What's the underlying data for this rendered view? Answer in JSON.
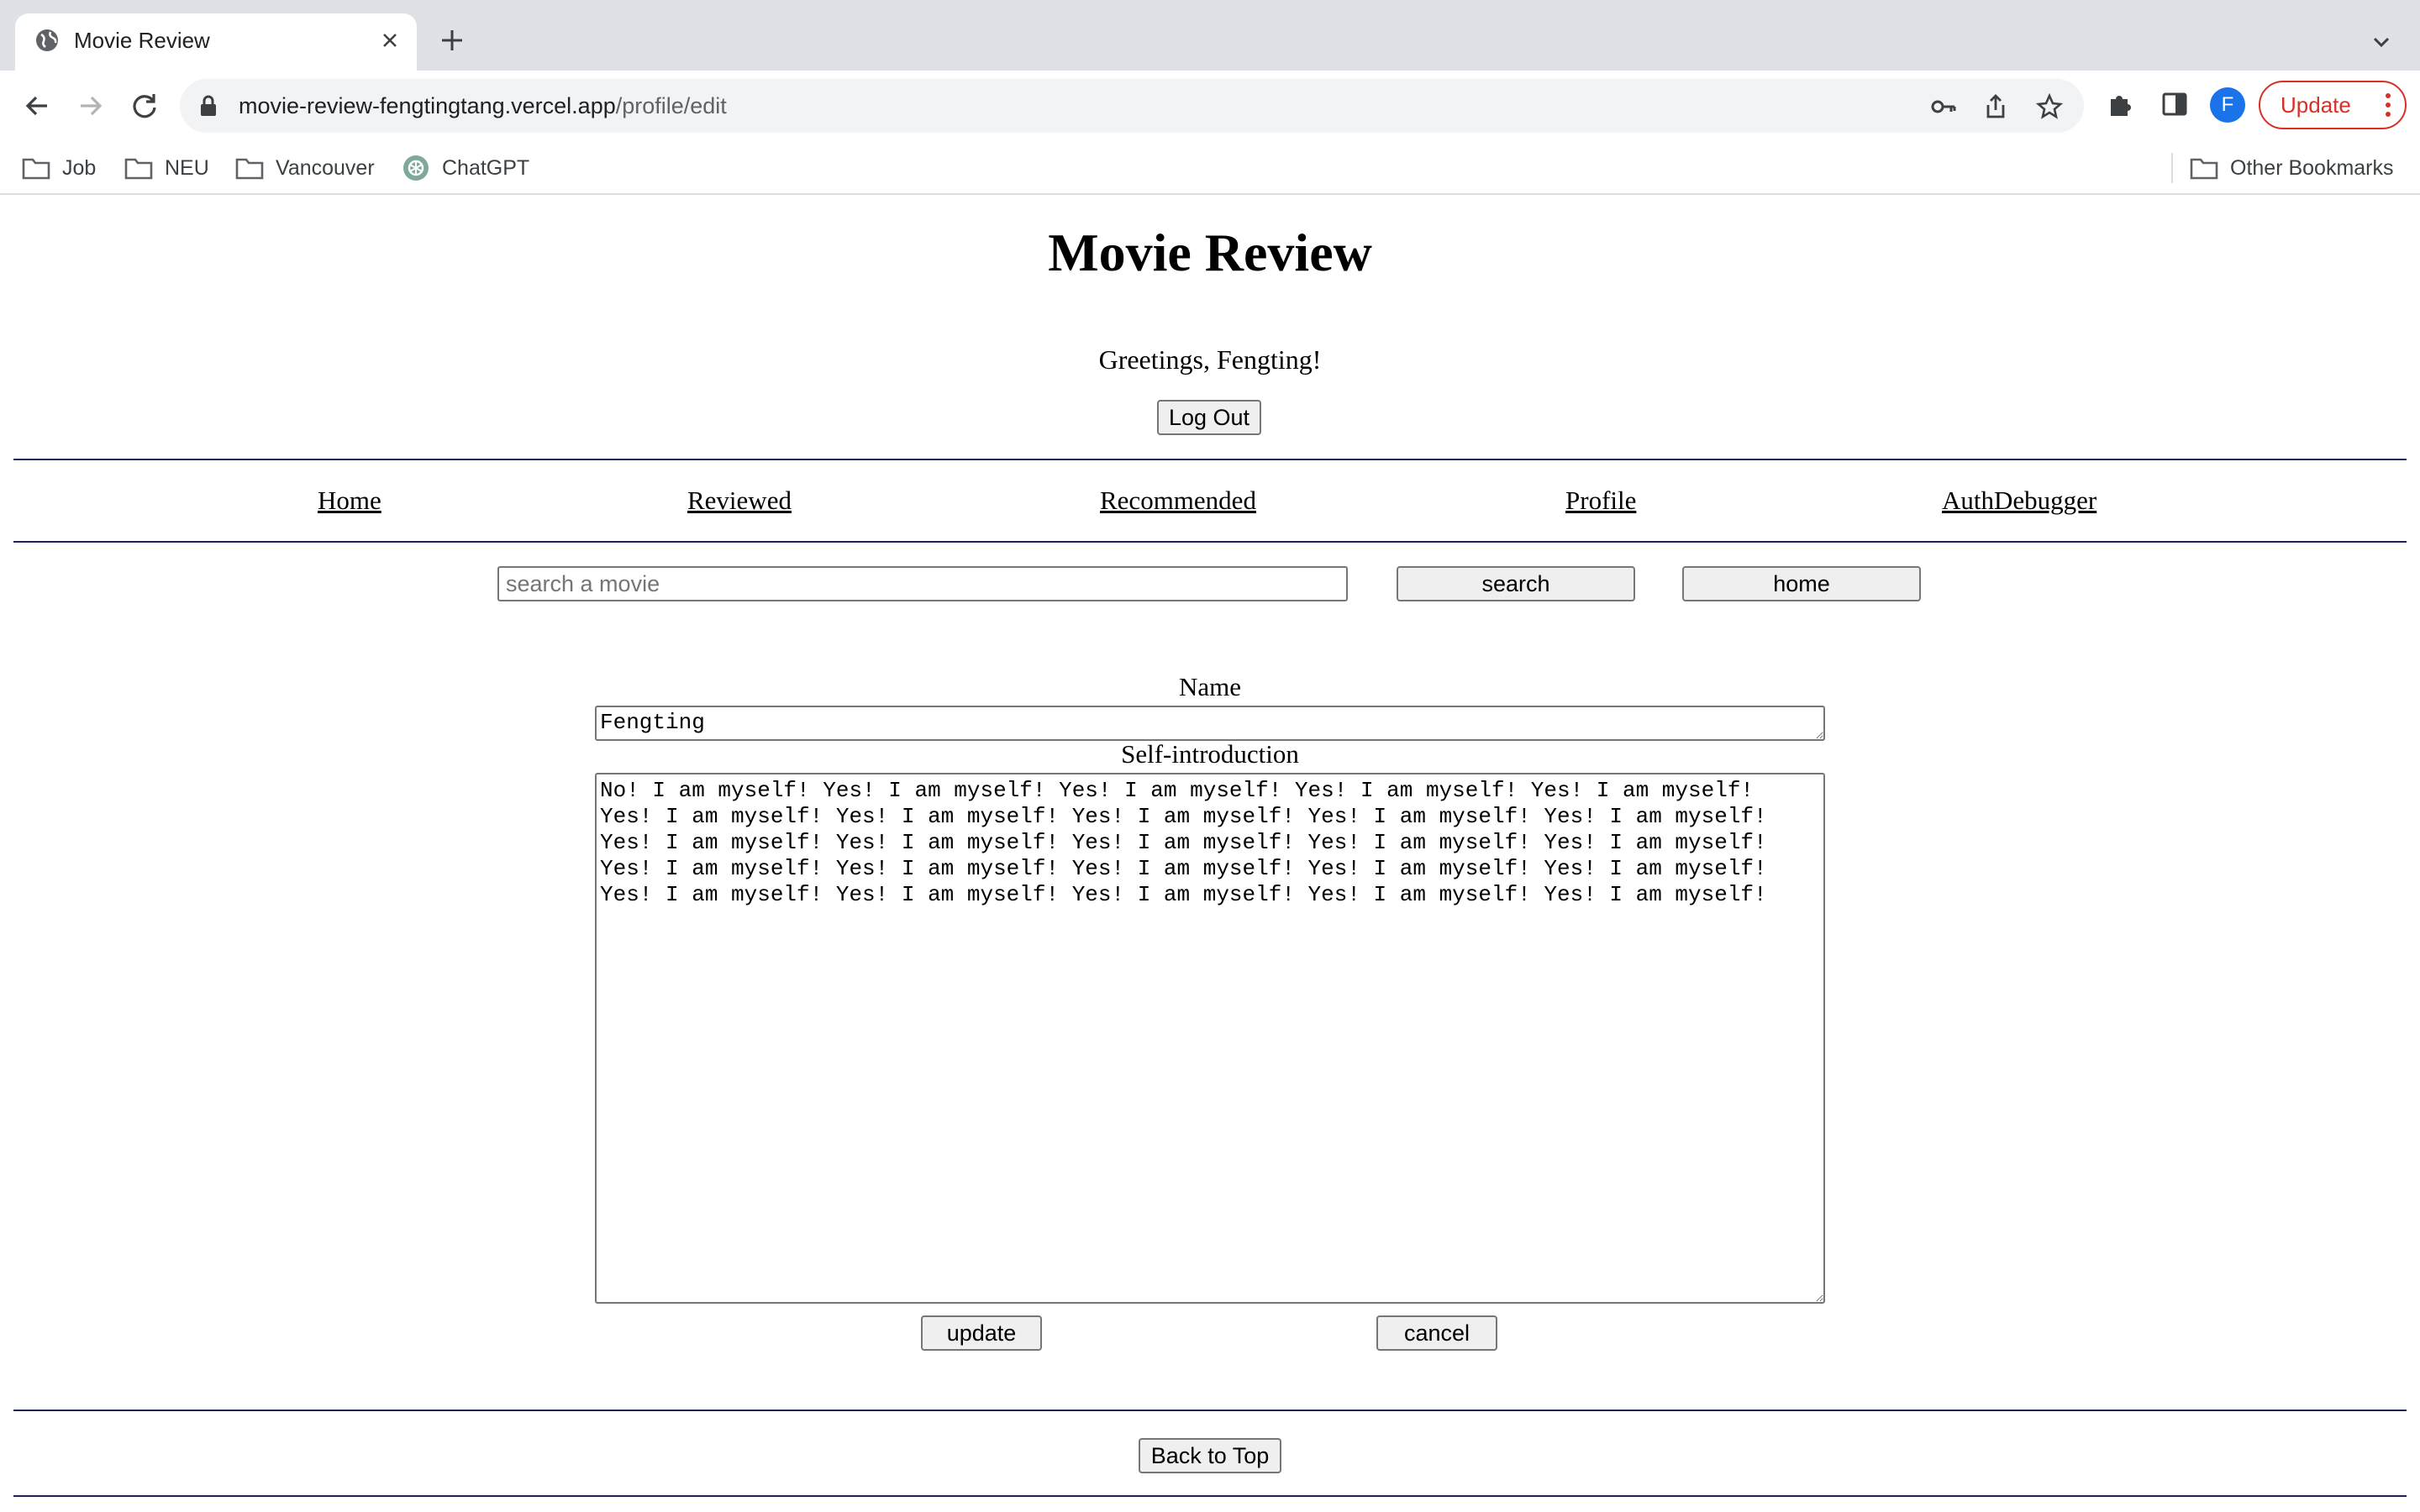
{
  "browser": {
    "tab_title": "Movie Review",
    "url_host": "movie-review-fengtingtang.vercel.app",
    "url_path": "/profile/edit",
    "profile_initial": "F",
    "update_label": "Update",
    "colors": {
      "tabstrip": "#dee1e6",
      "omnibox": "#f1f3f4",
      "update": "#d93025",
      "avatar": "#1a73e8"
    }
  },
  "bookmarks": {
    "items": [
      {
        "label": "Job",
        "icon": "folder-icon"
      },
      {
        "label": "NEU",
        "icon": "folder-icon"
      },
      {
        "label": "Vancouver",
        "icon": "folder-icon"
      },
      {
        "label": "ChatGPT",
        "icon": "chatgpt-icon"
      }
    ],
    "other": "Other Bookmarks"
  },
  "page": {
    "title": "Movie Review",
    "greeting": "Greetings, Fengting!",
    "logout_label": "Log Out",
    "nav": [
      "Home",
      "Reviewed",
      "Recommended",
      "Profile",
      "AuthDebugger"
    ],
    "search": {
      "placeholder": "search a movie",
      "value": "",
      "search_label": "search",
      "home_label": "home"
    },
    "form": {
      "name_label": "Name",
      "name_value": "Fengting",
      "intro_label": "Self-introduction",
      "intro_value": "No! I am myself! Yes! I am myself! Yes! I am myself! Yes! I am myself! Yes! I am myself!\nYes! I am myself! Yes! I am myself! Yes! I am myself! Yes! I am myself! Yes! I am myself!\nYes! I am myself! Yes! I am myself! Yes! I am myself! Yes! I am myself! Yes! I am myself!\nYes! I am myself! Yes! I am myself! Yes! I am myself! Yes! I am myself! Yes! I am myself!\nYes! I am myself! Yes! I am myself! Yes! I am myself! Yes! I am myself! Yes! I am myself!",
      "update_label": "update",
      "cancel_label": "cancel"
    },
    "back_to_top_label": "Back to Top",
    "divider_color": "#1f2354"
  }
}
